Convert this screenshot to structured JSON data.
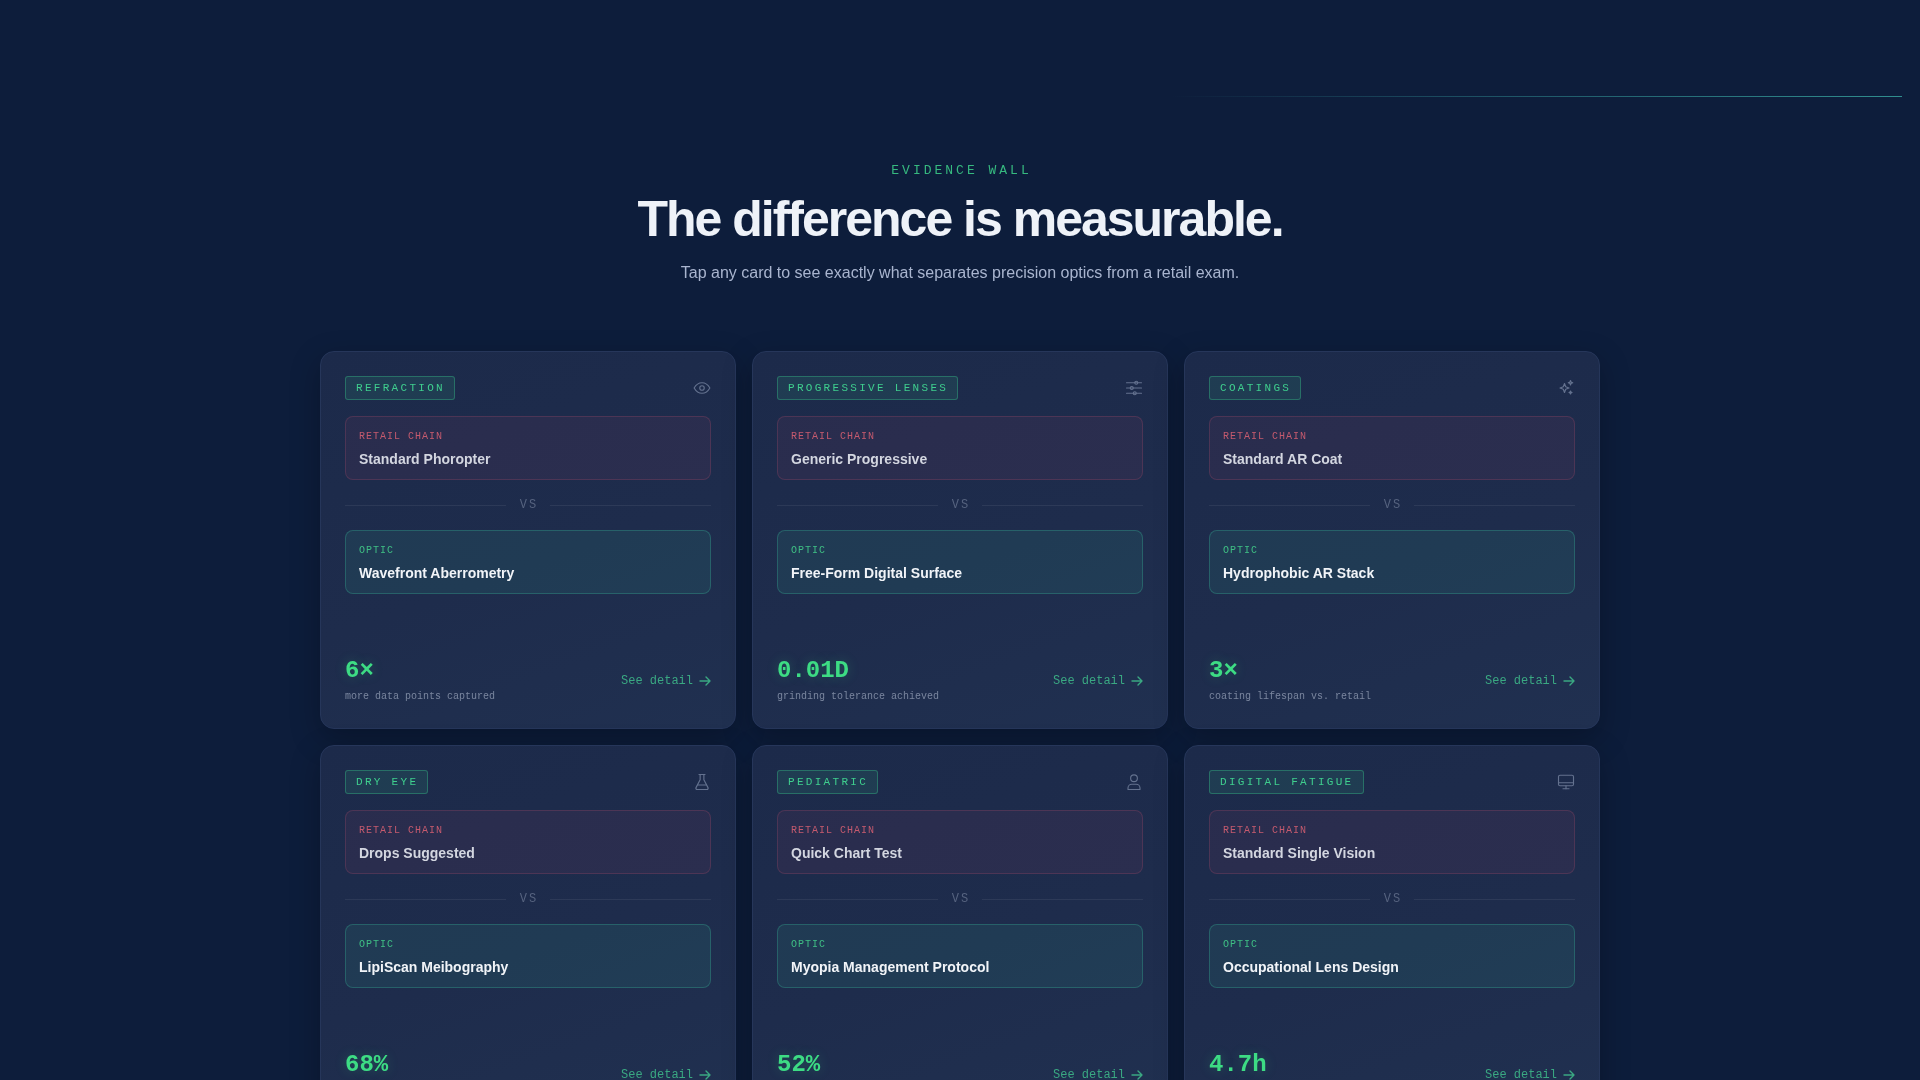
{
  "header": {
    "eyebrow": "EVIDENCE WALL",
    "title": "The difference is measurable.",
    "subtitle": "Tap any card to see exactly what separates precision optics from a retail exam."
  },
  "cards": [
    {
      "kind": "refraction",
      "category": "REFRACTION",
      "retail": {
        "label": "RETAIL CHAIN",
        "name": "Standard Phoropter"
      },
      "vs": "VS",
      "optic": {
        "label": "OPTIC",
        "name": "Wavefront Aberrometry"
      },
      "stat": {
        "value": "6×",
        "caption": "more data points captured"
      },
      "link": "See detail"
    },
    {
      "kind": "progressive",
      "category": "PROGRESSIVE LENSES",
      "retail": {
        "label": "RETAIL CHAIN",
        "name": "Generic Progressive"
      },
      "vs": "VS",
      "optic": {
        "label": "OPTIC",
        "name": "Free-Form Digital Surface"
      },
      "stat": {
        "value": "0.01D",
        "caption": "grinding tolerance achieved"
      },
      "link": "See detail"
    },
    {
      "kind": "coatings",
      "category": "COATINGS",
      "retail": {
        "label": "RETAIL CHAIN",
        "name": "Standard AR Coat"
      },
      "vs": "VS",
      "optic": {
        "label": "OPTIC",
        "name": "Hydrophobic AR Stack"
      },
      "stat": {
        "value": "3×",
        "caption": "coating lifespan vs. retail"
      },
      "link": "See detail"
    },
    {
      "kind": "dryeye",
      "category": "DRY EYE",
      "retail": {
        "label": "RETAIL CHAIN",
        "name": "Drops Suggested"
      },
      "vs": "VS",
      "optic": {
        "label": "OPTIC",
        "name": "LipiScan Meibography"
      },
      "stat": {
        "value": "68%"
      },
      "link": "See detail"
    },
    {
      "kind": "pediatric",
      "category": "PEDIATRIC",
      "retail": {
        "label": "RETAIL CHAIN",
        "name": "Quick Chart Test"
      },
      "vs": "VS",
      "optic": {
        "label": "OPTIC",
        "name": "Myopia Management Protocol"
      },
      "stat": {
        "value": "52%"
      },
      "link": "See detail"
    },
    {
      "kind": "screen",
      "category": "DIGITAL FATIGUE",
      "retail": {
        "label": "RETAIL CHAIN",
        "name": "Standard Single Vision"
      },
      "vs": "VS",
      "optic": {
        "label": "OPTIC",
        "name": "Occupational Lens Design"
      },
      "stat": {
        "value": "4.7h"
      },
      "link": "See detail"
    }
  ]
}
